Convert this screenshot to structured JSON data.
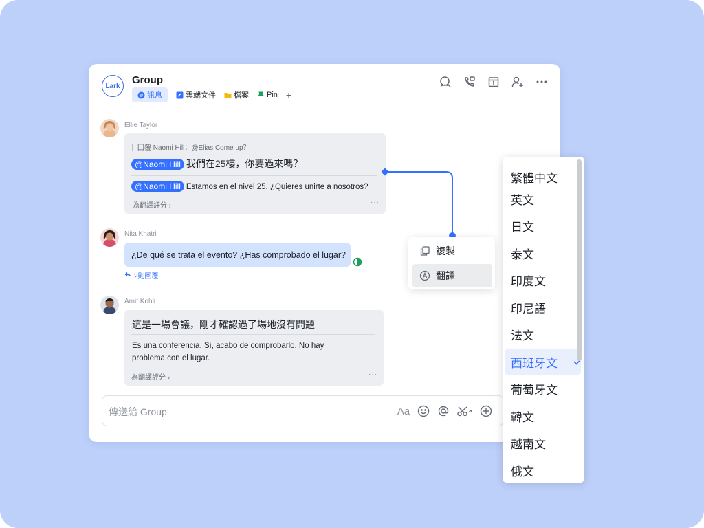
{
  "header": {
    "logo": "Lark",
    "title": "Group",
    "tabs": [
      {
        "label": "訊息",
        "icon": "chat-bubble-icon"
      },
      {
        "label": "雲端文件",
        "icon": "doc-icon"
      },
      {
        "label": "檔案",
        "icon": "folder-icon"
      },
      {
        "label": "Pin",
        "icon": "pin-icon"
      }
    ],
    "add_tab": "+",
    "actions": [
      "search-icon",
      "video-call-icon",
      "calendar-icon",
      "add-member-icon",
      "more-icon"
    ]
  },
  "messages": [
    {
      "sender": "Ellie Taylor",
      "reply_quote": "回覆 Naomi Hill：@Elias Come up？",
      "mention": "@Naomi Hill",
      "text": "我們在25樓，你要過來嗎？",
      "translation": "Estamos en el nivel 25. ¿Quieres unirte a nosotros?",
      "rate": "為翻譯評分",
      "more": "···"
    },
    {
      "sender": "Nita Khatri",
      "text": "¿De qué se trata el evento? ¿Has comprobado el lugar?",
      "replies": "2則回覆"
    },
    {
      "sender": "Amit Kohli",
      "text": "這是一場會議，剛才確認過了場地沒有問題",
      "translation_line1": "Es una conferencia. Sí, acabo de comprobarlo. No hay",
      "translation_line2": "problema con el lugar.",
      "rate": "為翻譯評分",
      "more": "···"
    }
  ],
  "composer": {
    "placeholder": "傳送給 Group",
    "font_icon_label": "Aa"
  },
  "context_menu": [
    {
      "label": "複製",
      "icon": "copy-icon"
    },
    {
      "label": "翻譯",
      "icon": "translate-icon"
    }
  ],
  "languages": {
    "items": [
      "繁體中文",
      "英文",
      "日文",
      "泰文",
      "印度文",
      "印尼語",
      "法文",
      "西班牙文",
      "葡萄牙文",
      "韓文",
      "越南文",
      "俄文"
    ],
    "selected": "西班牙文"
  },
  "colors": {
    "accent": "#3370ff",
    "background": "#bdd0fa",
    "bubble": "#eceef1",
    "bubble_own": "#d4e3fd"
  }
}
